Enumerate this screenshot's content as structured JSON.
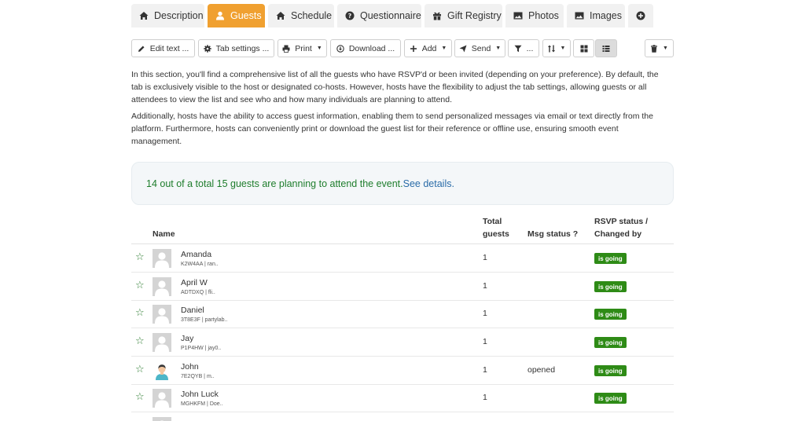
{
  "tabs": [
    {
      "label": "Description",
      "icon": "home-icon"
    },
    {
      "label": "Guests",
      "icon": "user-icon",
      "active": true
    },
    {
      "label": "Schedule",
      "icon": "home-icon"
    },
    {
      "label": "Questionnaire",
      "icon": "question-circle-icon"
    },
    {
      "label": "Gift Registry",
      "icon": "gift-icon"
    },
    {
      "label": "Photos",
      "icon": "image-icon"
    },
    {
      "label": "Images",
      "icon": "image-icon"
    },
    {
      "label": "",
      "icon": "plus-circle-icon"
    }
  ],
  "toolbar": {
    "edit_text": "Edit text ...",
    "tab_settings": "Tab settings ...",
    "print": "Print",
    "download": "Download ...",
    "add": "Add",
    "send": "Send",
    "filter": "...",
    "sort": "",
    "grid_view": "",
    "list_view": "",
    "delete": ""
  },
  "description": {
    "p1": "In this section, you'll find a comprehensive list of all the guests who have RSVP'd or been invited (depending on your preference). By default, the tab is exclusively visible to the host or designated co-hosts. However, hosts have the flexibility to adjust the tab settings, allowing guests or all attendees to view the list and see who and how many individuals are planning to attend.",
    "p2": "Additionally, hosts have the ability to access guest information, enabling them to send personalized messages via email or text directly from the platform. Furthermore, hosts can conveniently print or download the guest list for their reference or offline use, ensuring smooth event management."
  },
  "summary": {
    "text": "14 out of a total 15 guests are planning to attend the event.",
    "link": "See details."
  },
  "table": {
    "headers": {
      "name": "Name",
      "total_line1": "Total",
      "total_line2": "guests",
      "msg_status": "Msg status ?",
      "rsvp_line1": "RSVP status /",
      "rsvp_line2": "Changed by"
    },
    "rows": [
      {
        "name": "Amanda",
        "sub": "K2W4AA | ran..",
        "total": "1",
        "msg": "",
        "status": "is going",
        "avatar": "placeholder"
      },
      {
        "name": "April W",
        "sub": "ADTDXQ | fli..",
        "total": "1",
        "msg": "",
        "status": "is going",
        "avatar": "placeholder"
      },
      {
        "name": "Daniel",
        "sub": "3T8E3F | partylab..",
        "total": "1",
        "msg": "",
        "status": "is going",
        "avatar": "placeholder"
      },
      {
        "name": "Jay",
        "sub": "P1P4HW | jay0..",
        "total": "1",
        "msg": "",
        "status": "is going",
        "avatar": "placeholder"
      },
      {
        "name": "John",
        "sub": "7E2QYB | m..",
        "total": "1",
        "msg": "opened",
        "status": "is going",
        "avatar": "person"
      },
      {
        "name": "John Luck",
        "sub": "MGHKFM | Doe..",
        "total": "1",
        "msg": "",
        "status": "is going",
        "avatar": "placeholder"
      }
    ]
  },
  "colors": {
    "active_tab": "#f0a030",
    "going_badge": "#2e8b16",
    "summary_text": "#1e7d2c",
    "link": "#2a6ca8"
  }
}
